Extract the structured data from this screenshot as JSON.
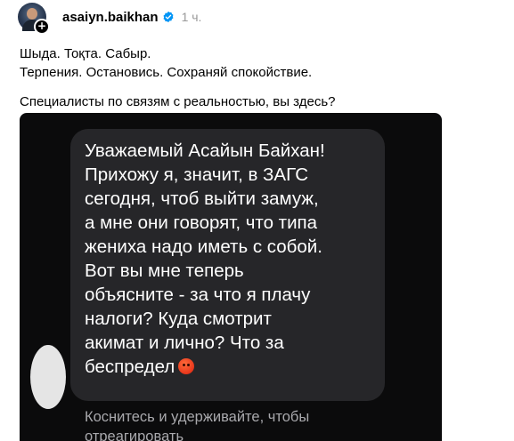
{
  "post": {
    "username": "asaiyn.baikhan",
    "time": "1 ч.",
    "lines": [
      "Шыда. Тоқта. Сабыр.",
      "Терпения. Остановись. Сохраняй спокойствие."
    ],
    "question": "Специалисты по связям с реальностью, вы здесь?"
  },
  "media": {
    "message": "Уважаемый Асайын Байхан!\nПрихожу я, значит, в ЗАГС\nсегодня, чтоб выйти замуж,\nа мне они говорят, что типа\nжениха надо иметь с собой.\nВот вы мне теперь\nобъясните - за что я плачу\nналоги? Куда смотрит\nакимат и лично? Что за\nбеспредел",
    "hint_line1": "Коснитесь и удерживайте, чтобы",
    "hint_line2": "отреагировать"
  },
  "icons": {
    "verified": "verified-badge-icon",
    "plus": "add-plus-icon",
    "emoji": "angry-face-emoji"
  },
  "colors": {
    "verified": "#0095f6",
    "bubble": "#262629",
    "media_bg": "#0b0b0c"
  }
}
